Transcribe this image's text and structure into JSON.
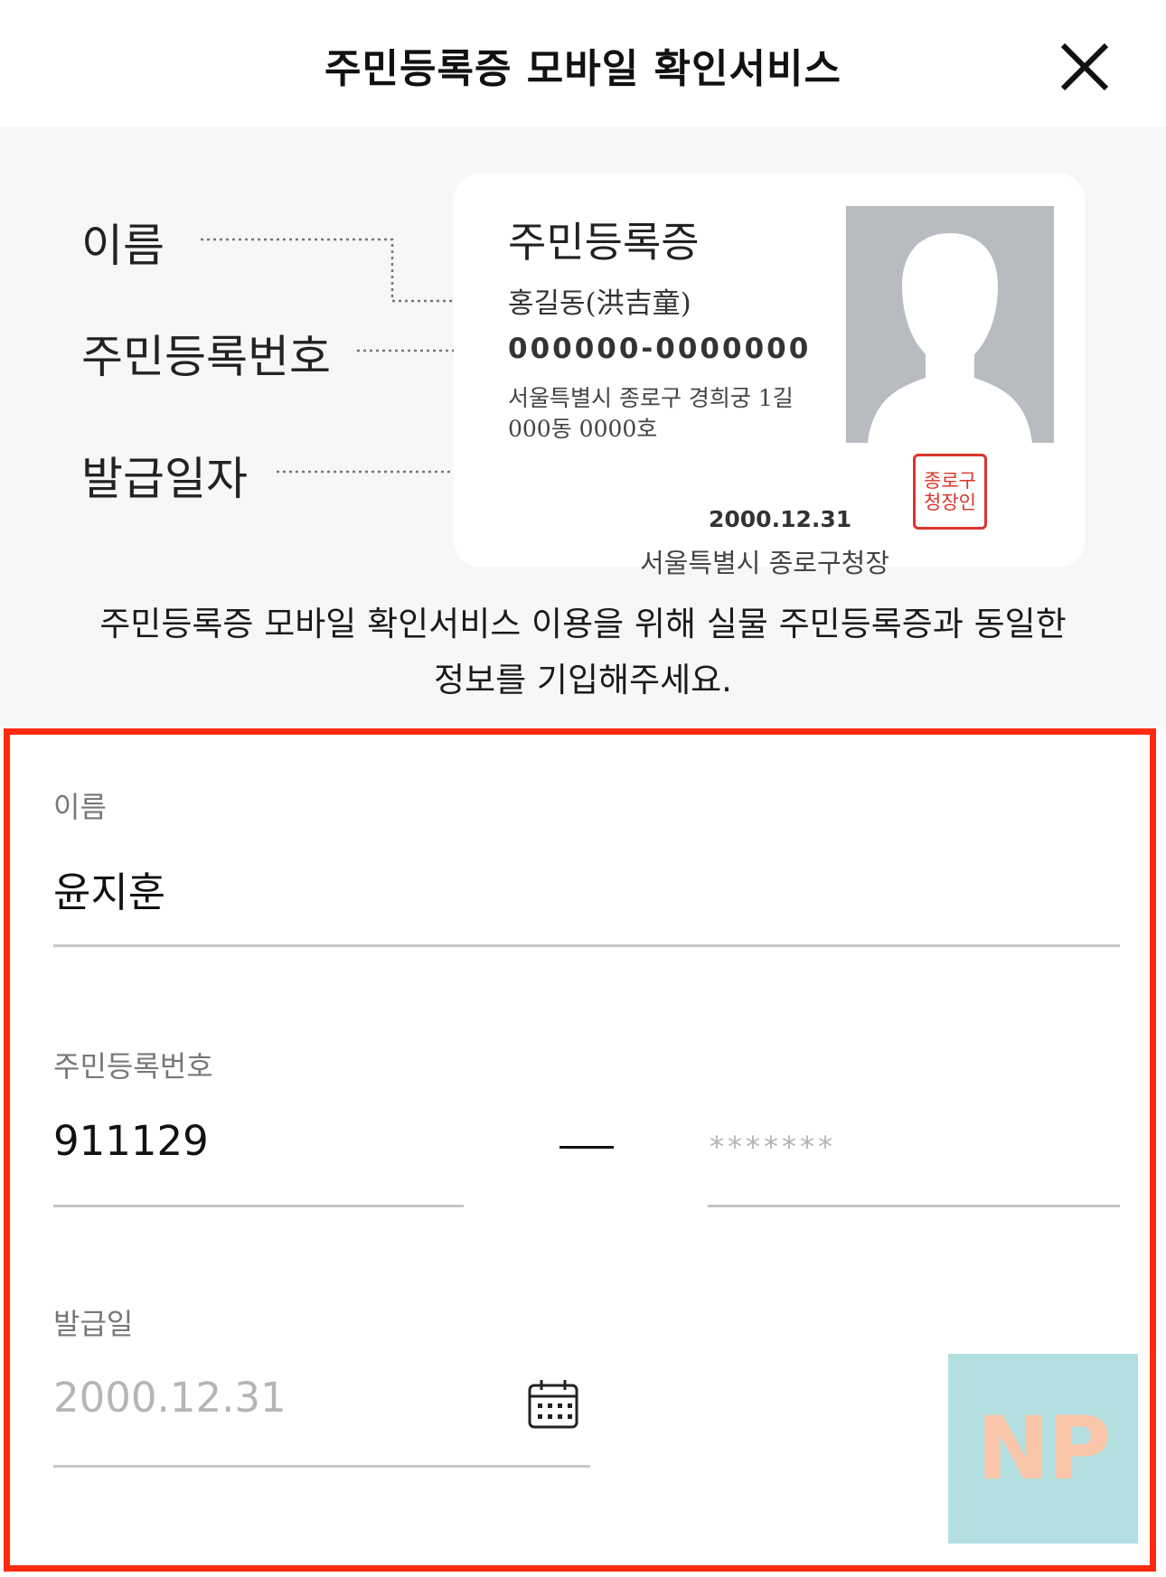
{
  "header": {
    "title": "주민등록증 모바일 확인서비스",
    "close_icon": "close-icon"
  },
  "guide": {
    "labels": {
      "name": "이름",
      "rrn": "주민등록번호",
      "issue_date": "발급일자"
    },
    "card": {
      "title": "주민등록증",
      "name": "홍길동(洪吉童)",
      "number": "000000-0000000",
      "address_line1": "서울특별시 종로구 경희궁 1길",
      "address_line2": "000동 0000호",
      "date": "2000.12.31",
      "issuer": "서울특별시 종로구청장",
      "seal_line1": "종로구",
      "seal_line2": "청장인"
    },
    "description": "주민등록증 모바일 확인서비스 이용을 위해 실물 주민등록증과 동일한 정보를 기입해주세요."
  },
  "form": {
    "name": {
      "label": "이름",
      "value": "윤지훈"
    },
    "rrn": {
      "label": "주민등록번호",
      "front_value": "911129",
      "back_placeholder": "*******"
    },
    "issue_date": {
      "label": "발급일",
      "placeholder": "2000.12.31",
      "icon": "calendar-icon"
    }
  },
  "watermark": "NP",
  "colors": {
    "highlight_border": "#ff2a10",
    "guide_background": "#f6f7f9",
    "seal": "#d9342b",
    "photo_placeholder": "#b8bcc1"
  }
}
